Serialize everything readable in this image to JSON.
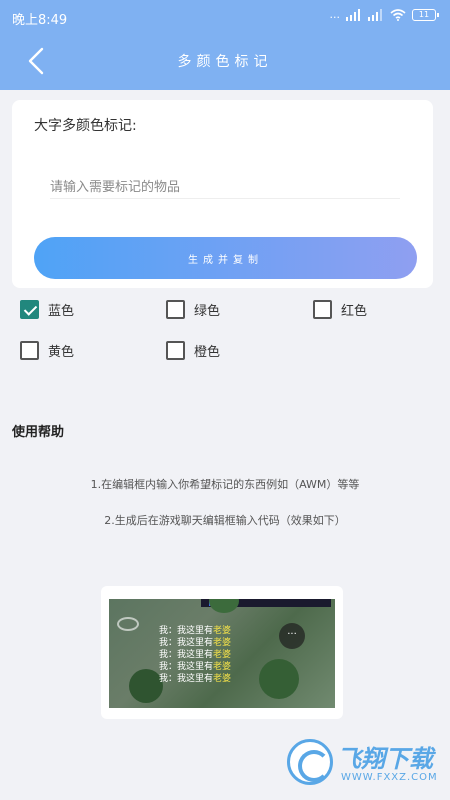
{
  "status_bar": {
    "time": "晚上8:49",
    "network": "...",
    "battery": "11"
  },
  "header": {
    "title": "多颜色标记"
  },
  "form": {
    "label": "大字多颜色标记:",
    "input_value": "",
    "input_placeholder": "请输入需要标记的物品",
    "button_label": "生成并复制"
  },
  "colors": [
    {
      "label": "蓝色",
      "checked": true
    },
    {
      "label": "绿色",
      "checked": false
    },
    {
      "label": "红色",
      "checked": false
    },
    {
      "label": "黄色",
      "checked": false
    },
    {
      "label": "橙色",
      "checked": false
    }
  ],
  "help": {
    "title": "使用帮助",
    "lines": [
      "1.在编辑框内输入你希望标记的东西例如（AWM）等等",
      "2.生成后在游戏聊天编辑框输入代码（效果如下）"
    ]
  },
  "example": {
    "chat": [
      {
        "prefix": "我：我这里有",
        "highlight": "老婆"
      },
      {
        "prefix": "我：我这里有",
        "highlight": "老婆"
      },
      {
        "prefix": "我：我这里有",
        "highlight": "老婆"
      },
      {
        "prefix": "我：我这里有",
        "highlight": "老婆"
      },
      {
        "prefix": "我：我这里有",
        "highlight": "老婆"
      }
    ],
    "chat_icon": "···"
  },
  "watermark": {
    "text": "飞翔下载",
    "url": "WWW.FXXZ.COM"
  },
  "theme": {
    "accent": "#7fb1f2",
    "checkbox_checked": "#21877d",
    "button_gradient_start": "#4fa3f6",
    "button_gradient_end": "#8f9ff1"
  }
}
